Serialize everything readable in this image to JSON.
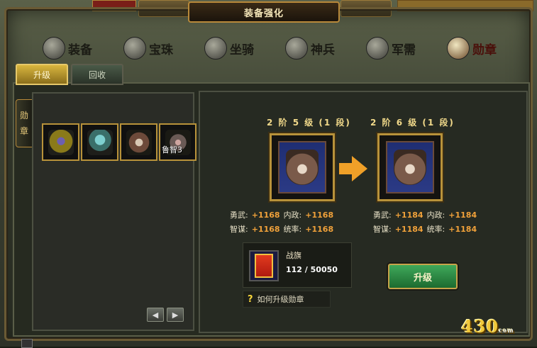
{
  "window": {
    "title": "装备强化"
  },
  "categories": [
    {
      "label": "装备",
      "icon": "helmet-icon"
    },
    {
      "label": "宝珠",
      "icon": "orb-icon"
    },
    {
      "label": "坐骑",
      "icon": "horse-icon"
    },
    {
      "label": "神兵",
      "icon": "sword-icon"
    },
    {
      "label": "军需",
      "icon": "supplies-icon"
    },
    {
      "label": "勋章",
      "icon": "medal-icon"
    }
  ],
  "tabs": [
    {
      "label": "升级"
    },
    {
      "label": "回收"
    }
  ],
  "side_tab": {
    "line1": "勋",
    "line2": "章"
  },
  "inventory": [
    {
      "icon": "medal-gold-purple-icon",
      "label": ""
    },
    {
      "icon": "medal-teal-icon",
      "label": ""
    },
    {
      "icon": "medal-shield-icon",
      "label": ""
    },
    {
      "icon": "medal-star-icon",
      "label": "鲁智3"
    }
  ],
  "pager": {
    "prev": "◀",
    "next": "▶"
  },
  "current": {
    "stage": "2 阶 5 级 (1 段)",
    "stats": {
      "k1": "勇武:",
      "v1": "+1168",
      "k2": "内政:",
      "v2": "+1168",
      "k3": "智谋:",
      "v3": "+1168",
      "k4": "统率:",
      "v4": "+1168"
    }
  },
  "next": {
    "stage": "2 阶 6 级 (1 段)",
    "stats": {
      "k1": "勇武:",
      "v1": "+1184",
      "k2": "内政:",
      "v2": "+1184",
      "k3": "智谋:",
      "v3": "+1184",
      "k4": "统率:",
      "v4": "+1184"
    }
  },
  "requirement": {
    "name": "战旗",
    "progress": "112 / 50050"
  },
  "upgrade_button": "升级",
  "help": {
    "mark": "?",
    "text": "如何升级勋章"
  },
  "logo": {
    "text": "430",
    "sub": "com"
  },
  "colors": {
    "accent": "#f0a13a",
    "gold_border": "#b8923a",
    "button_green": "#2f8a46"
  }
}
